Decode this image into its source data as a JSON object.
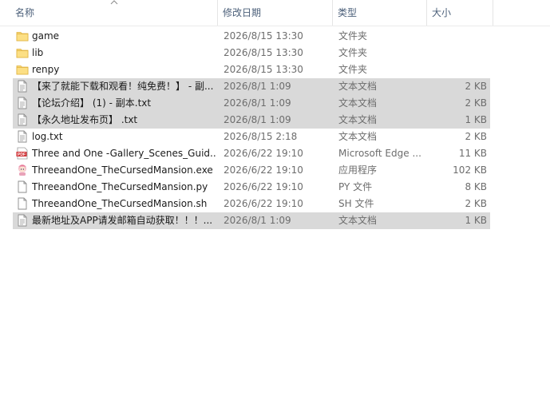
{
  "columns": {
    "name": "名称",
    "date": "修改日期",
    "type": "类型",
    "size": "大小"
  },
  "files": [
    {
      "name": "game",
      "date": "2026/8/15 13:30",
      "type": "文件夹",
      "size": "",
      "icon": "folder-icon",
      "selected": false
    },
    {
      "name": "lib",
      "date": "2026/8/15 13:30",
      "type": "文件夹",
      "size": "",
      "icon": "folder-icon",
      "selected": false
    },
    {
      "name": "renpy",
      "date": "2026/8/15 13:30",
      "type": "文件夹",
      "size": "",
      "icon": "folder-icon",
      "selected": false
    },
    {
      "name": "【来了就能下载和观看！纯免费！】 - 副...",
      "date": "2026/8/1 1:09",
      "type": "文本文档",
      "size": "2 KB",
      "icon": "text-file-icon",
      "selected": true
    },
    {
      "name": "【论坛介绍】 (1) - 副本.txt",
      "date": "2026/8/1 1:09",
      "type": "文本文档",
      "size": "2 KB",
      "icon": "text-file-icon",
      "selected": true
    },
    {
      "name": "【永久地址发布页】 .txt",
      "date": "2026/8/1 1:09",
      "type": "文本文档",
      "size": "1 KB",
      "icon": "text-file-icon",
      "selected": true
    },
    {
      "name": "log.txt",
      "date": "2026/8/15 2:18",
      "type": "文本文档",
      "size": "2 KB",
      "icon": "text-file-icon",
      "selected": false
    },
    {
      "name": "Three and One -Gallery_Scenes_Guid...",
      "date": "2026/6/22 19:10",
      "type": "Microsoft Edge ...",
      "size": "11 KB",
      "icon": "pdf-icon",
      "selected": false
    },
    {
      "name": "ThreeandOne_TheCursedMansion.exe",
      "date": "2026/6/22 19:10",
      "type": "应用程序",
      "size": "102 KB",
      "icon": "app-icon",
      "selected": false
    },
    {
      "name": "ThreeandOne_TheCursedMansion.py",
      "date": "2026/6/22 19:10",
      "type": "PY 文件",
      "size": "8 KB",
      "icon": "blank-file-icon",
      "selected": false
    },
    {
      "name": "ThreeandOne_TheCursedMansion.sh",
      "date": "2026/6/22 19:10",
      "type": "SH 文件",
      "size": "2 KB",
      "icon": "blank-file-icon",
      "selected": false
    },
    {
      "name": "最新地址及APP请发邮箱自动获取！！！...",
      "date": "2026/8/1 1:09",
      "type": "文本文档",
      "size": "1 KB",
      "icon": "text-file-icon",
      "selected": true
    }
  ],
  "pdf_badge": "PDF"
}
